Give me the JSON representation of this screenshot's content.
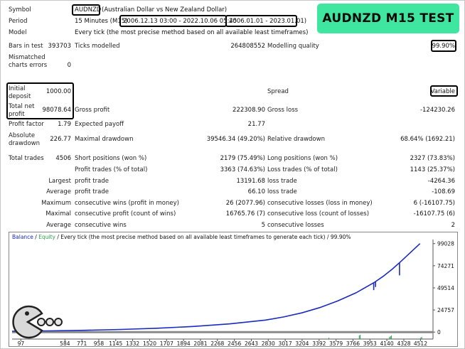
{
  "header": {
    "symbol_label": "Symbol",
    "symbol_value": "AUDNZD",
    "symbol_desc": "(Australian Dollar vs New Zealand Dollar)",
    "period_label": "Period",
    "period_prefix": "15 Minutes (M15)",
    "period_range": "2006.12.13 03:00 - 2022.10.06 05:45",
    "period_suffix": "2006.01.01 - 2023.01.01)",
    "model_label": "Model",
    "model_value": "Every tick (the most precise method based on all available least timeframes)",
    "badge": "AUDNZD M15 TEST"
  },
  "stats": {
    "bars_label": "Bars in test",
    "bars_value": "393703",
    "ticks_label": "Ticks modelled",
    "ticks_value": "264808552",
    "quality_label": "Modelling quality",
    "quality_value": "99.90%",
    "mismatch_label": "Mismatched charts errors",
    "mismatch_value": "0",
    "deposit_label": "Initial deposit",
    "deposit_value": "1000.00",
    "spread_label": "Spread",
    "spread_value": "Variable",
    "netprofit_label": "Total net profit",
    "netprofit_value": "98078.64",
    "grossprofit_label": "Gross profit",
    "grossprofit_value": "222308.90",
    "grossloss_label": "Gross loss",
    "grossloss_value": "-124230.26",
    "pf_label": "Profit factor",
    "pf_value": "1.79",
    "payoff_label": "Expected payoff",
    "payoff_value": "21.77",
    "absdd_label": "Absolute drawdown",
    "absdd_value": "226.77",
    "maxdd_label": "Maximal drawdown",
    "maxdd_value": "39546.34 (49.20%)",
    "reldd_label": "Relative drawdown",
    "reldd_value": "68.64% (1692.21)",
    "trades_label": "Total trades",
    "trades_value": "4506",
    "short_label": "Short positions (won %)",
    "short_value": "2179 (75.49%)",
    "long_label": "Long positions (won %)",
    "long_value": "2327 (73.83%)",
    "ptrades_label": "Profit trades (% of total)",
    "ptrades_value": "3363 (74.63%)",
    "ltrades_label": "Loss trades (% of total)",
    "ltrades_value": "1143 (25.37%)",
    "largest_label": "Largest",
    "lp_label": "profit trade",
    "lp_value": "13191.68",
    "ll_label": "loss trade",
    "ll_value": "-4264.36",
    "average_label": "Average",
    "ap_label": "profit trade",
    "ap_value": "66.10",
    "al_label": "loss trade",
    "al_value": "-108.69",
    "maximum_label": "Maximum",
    "mcw_label": "consecutive wins (profit in money)",
    "mcw_value": "26 (2077.96)",
    "mcl_label": "consecutive losses (loss in money)",
    "mcl_value": "6 (-16107.75)",
    "maximal_label": "Maximal",
    "mcp_label": "consecutive profit (count of wins)",
    "mcp_value": "16765.76 (7)",
    "mclc_label": "consecutive loss (count of losses)",
    "mclc_value": "-16107.75 (6)",
    "average2_label": "Average",
    "acw_label": "consecutive wins",
    "acw_value": "5",
    "acl_label": "consecutive losses",
    "acl_value": "2"
  },
  "chart": {
    "legend_balance": "Balance",
    "legend_sep": " / ",
    "legend_equity": "Equity",
    "legend_rest": " / Every tick (the most precise method based on all available least timeframes to generate each tick) / 99.90%",
    "colors": {
      "balance": "#1a2bbf",
      "equity": "#2aa84a",
      "baseline": "#8a8a8a"
    }
  },
  "chart_data": {
    "type": "line",
    "title": "",
    "xlabel": "",
    "ylabel": "",
    "xlim": [
      0,
      4650
    ],
    "ylim": [
      -3000,
      102000
    ],
    "y_ticks": [
      0,
      24757,
      49514,
      74271,
      99028
    ],
    "x_ticks": [
      97,
      584,
      771,
      958,
      1145,
      1332,
      1520,
      1707,
      1894,
      2081,
      2268,
      2456,
      2643,
      2830,
      3017,
      3204,
      3392,
      3579,
      3766,
      3953,
      4140,
      4328,
      4512
    ],
    "x_tick_labels": [
      "97",
      "584",
      "771",
      "958",
      "1145",
      "1332",
      "1520",
      "1707",
      "1894",
      "2081",
      "2268",
      "2456",
      "2643",
      "2830",
      "3017",
      "3204",
      "3392",
      "3579",
      "3766",
      "3953",
      "4140",
      "4328",
      "4512"
    ],
    "series": [
      {
        "name": "Balance",
        "x": [
          0,
          400,
          800,
          1200,
          1600,
          2000,
          2400,
          2800,
          3000,
          3200,
          3400,
          3600,
          3800,
          4000,
          4100,
          4200,
          4300,
          4400,
          4506
        ],
        "values": [
          1000,
          1400,
          2000,
          3000,
          4300,
          6300,
          9200,
          13500,
          17000,
          21500,
          27500,
          35000,
          44000,
          55500,
          62500,
          70500,
          79500,
          89000,
          99028
        ]
      }
    ],
    "drawdown_spikes": [
      {
        "x": 3995,
        "value": 47000
      },
      {
        "x": 4015,
        "value": 50500
      },
      {
        "x": 4280,
        "value": 63500
      }
    ]
  }
}
